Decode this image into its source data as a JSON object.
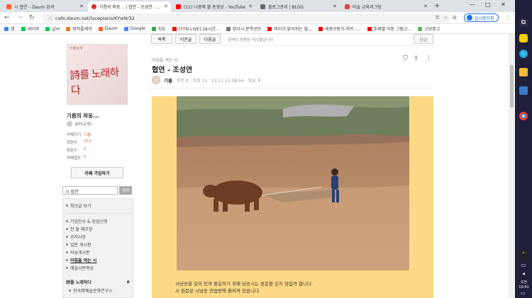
{
  "browser": {
    "tabs": [
      {
        "title": "시 협연 – Daum 검색",
        "favicon_color": "#ff5f2e"
      },
      {
        "title": "기름의 파동... | 협연 - 조성연 · ...",
        "favicon_color": "#d93025"
      },
      {
        "title": "(11) 나중에 볼 동영상 - YouTube",
        "favicon_color": "#ff0000"
      },
      {
        "title": "블로그관리 | BLOG",
        "favicon_color": "#666666"
      },
      {
        "title": "미술 교육과그림",
        "favicon_color": "#e8453c"
      }
    ],
    "new_tab": "+",
    "window_controls": {
      "minimize": "—",
      "maximize": "□",
      "close": "✕"
    },
    "url": "cafe.daum.net/lucepiano/KYwN/32",
    "pause_label": "일시중지됨",
    "bookmarks": [
      {
        "label": "앱",
        "color": "#4285f4"
      },
      {
        "label": "네이버",
        "color": "#03c75a"
      },
      {
        "label": "날씨",
        "color": "#03c75a"
      },
      {
        "label": "왕저플레이",
        "color": "#e67e22"
      },
      {
        "label": "Daum",
        "color": "#ff5f2e"
      },
      {
        "label": "Google",
        "color": "#4285f4"
      },
      {
        "label": "지도",
        "color": "#34a853"
      },
      {
        "label": "[YTN LIVE] 24시간...",
        "color": "#ff0000"
      },
      {
        "label": "엽서시 문학공모",
        "color": "#777777"
      },
      {
        "label": "머리가 맑아지는 힐...",
        "color": "#ff0000"
      },
      {
        "label": "세종이랑가-하트 -...",
        "color": "#ff0000"
      },
      {
        "label": "주제별 아동 그림고...",
        "color": "#ff0000"
      },
      {
        "label": "고보증고",
        "color": "#5cb85c"
      }
    ]
  },
  "sidebar": {
    "cafe_image_text": "詩를 노래하다",
    "cafe_image_corner": "카페소개",
    "cafe_name": "기름의 파동...",
    "member_name": "실버(운영)",
    "stats": [
      {
        "label": "카페지기",
        "value": "기름"
      },
      {
        "label": "회원수",
        "value": "253"
      },
      {
        "label": "방문수",
        "value": "0"
      },
      {
        "label": "카페앱수",
        "value": "0"
      }
    ],
    "join_button": "카페 가입하기",
    "search_value": "시 협연",
    "search_button": "검색",
    "menu_all": "최신글 보기",
    "menu_items": [
      "가입인사 & 등업신청",
      "한 줄 메모장",
      "공지사항",
      "일반 게시판",
      "자유게시판",
      "아침을 여는 시",
      "매일시편묵상"
    ],
    "section_title": "詩를 노래하다",
    "section_item": "한국詩예술문화연구소"
  },
  "article": {
    "top_buttons": [
      "목록",
      "이전글",
      "다음글"
    ],
    "top_note": "검색이 허용된 게시물입니다",
    "reply_button": "답글",
    "category": "아침을 여는 시",
    "title": "협연 - 조성연",
    "author": "기름",
    "meta": "추천 0   조회 15   13.11.13 08:54   댓글",
    "comment_count": "1",
    "caption_line1": "시냥송을 길이 있게 즐길하기 위해 낭송시는 원문을 싣지 않음까 합니다.",
    "caption_line2": "시 원문은 시낭송 연습방에 올려져 있습니다."
  },
  "taskbar": {
    "clock_time": "오전 10:01"
  }
}
